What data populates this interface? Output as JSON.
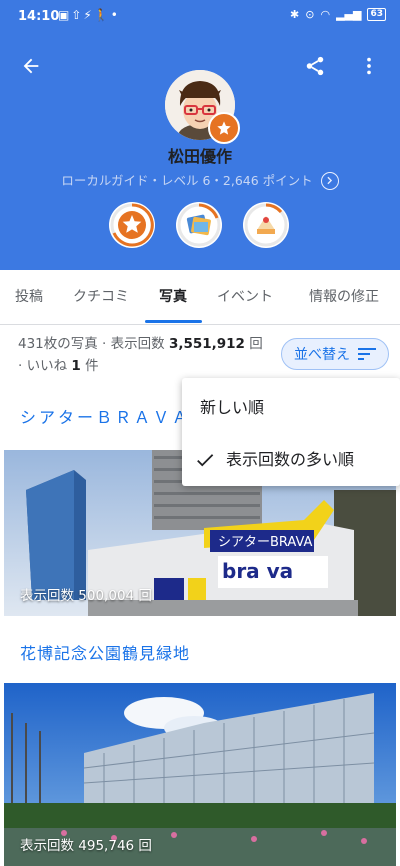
{
  "status_bar": {
    "time": "14:10",
    "battery": "63"
  },
  "profile": {
    "name": "松田優作",
    "guide_line": "ローカルガイド・レベル 6・2,646 ポイント"
  },
  "tabs": [
    {
      "label": "投稿",
      "active": false
    },
    {
      "label": "クチコミ",
      "active": false
    },
    {
      "label": "写真",
      "active": true
    },
    {
      "label": "イベント",
      "active": false
    },
    {
      "label": "情報の修正",
      "active": false
    }
  ],
  "stats": {
    "photos_prefix": "431枚の写真 · 表示回数 ",
    "views": "3,551,912",
    "views_suffix": " 回",
    "likes_prefix": "· いいね ",
    "likes": "1",
    "likes_suffix": " 件"
  },
  "sort_button_label": "並べ替え",
  "sort_menu": [
    {
      "label": "新しい順",
      "checked": false
    },
    {
      "label": "表示回数の多い順",
      "checked": true
    }
  ],
  "places": [
    {
      "title": "シアターＢＲＡＶＡ",
      "views_text": "表示回数 500,004 回"
    },
    {
      "title": "花博記念公園鶴見緑地",
      "views_text": "表示回数 495,746 回"
    }
  ],
  "photo_signage": "シアターBRAVA",
  "colors": {
    "header_blue": "#3c79e2",
    "accent": "#1a73e8",
    "badge_orange": "#e67322"
  }
}
